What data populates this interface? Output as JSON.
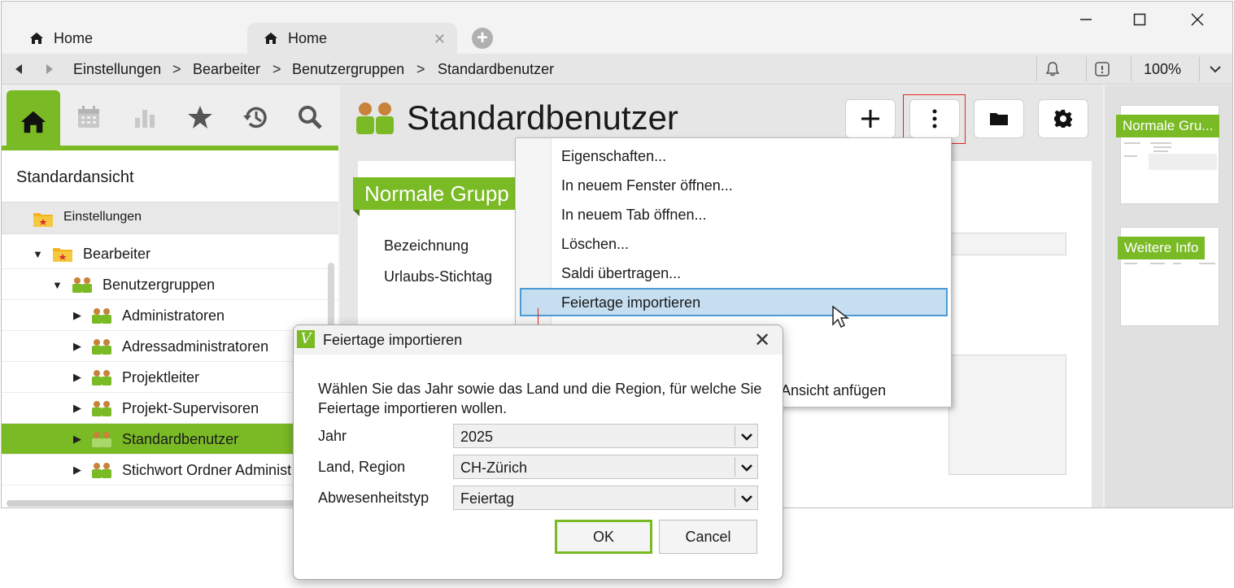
{
  "tabs": [
    {
      "label": "Home",
      "icon": "home-icon"
    },
    {
      "label": "Home",
      "icon": "home-icon",
      "active": true
    }
  ],
  "breadcrumb": {
    "items": [
      "Einstellungen",
      "Bearbeiter",
      "Benutzergruppen",
      "Standardbenutzer"
    ],
    "separator": ">",
    "zoom": "100%"
  },
  "sidebar": {
    "view_title": "Standardansicht",
    "nav_icons": [
      "home-icon",
      "calendar-icon",
      "chart-icon",
      "star-icon",
      "history-icon",
      "search-icon"
    ],
    "tree": [
      {
        "label": "Einstellungen",
        "icon": "folder-settings-icon"
      },
      {
        "label": "Bearbeiter",
        "icon": "folder-settings-icon",
        "expanded": true
      },
      {
        "label": "Benutzergruppen",
        "icon": "group-icon",
        "expanded": true
      },
      {
        "label": "Administratoren",
        "icon": "group-icon"
      },
      {
        "label": "Adressadministratoren",
        "icon": "group-icon"
      },
      {
        "label": "Projektleiter",
        "icon": "group-icon"
      },
      {
        "label": "Projekt-Supervisoren",
        "icon": "group-icon"
      },
      {
        "label": "Standardbenutzer",
        "icon": "group-icon",
        "selected": true
      },
      {
        "label": "Stichwort Ordner Administ",
        "icon": "group-icon"
      }
    ]
  },
  "main": {
    "title": "Standardbenutzer",
    "section_label": "Normale Grupp",
    "fields": [
      "Bezeichnung",
      "Urlaubs-Stichtag"
    ],
    "partial_text": "Ansicht anfügen"
  },
  "context_menu": {
    "items": [
      "Eigenschaften...",
      "In neuem Fenster öffnen...",
      "In neuem Tab öffnen...",
      "Löschen...",
      "Saldi übertragen...",
      "Feiertage importieren"
    ],
    "highlighted_index": 5
  },
  "right_panel": {
    "thumbnails": [
      {
        "label": "Normale Gru..."
      },
      {
        "label": "Weitere Info"
      }
    ]
  },
  "dialog": {
    "title": "Feiertage importieren",
    "description": "Wählen Sie das Jahr sowie das Land und die Region, für welche Sie Feiertage importieren wollen.",
    "fields": [
      {
        "label": "Jahr",
        "value": "2025"
      },
      {
        "label": "Land, Region",
        "value": "CH-Zürich"
      },
      {
        "label": "Abwesenheitstyp",
        "value": "Feiertag"
      }
    ],
    "ok_label": "OK",
    "cancel_label": "Cancel"
  },
  "colors": {
    "accent": "#7aba25",
    "highlight": "#c5def0",
    "highlight_border": "#4c9bd4",
    "annotation": "#e0241b"
  }
}
